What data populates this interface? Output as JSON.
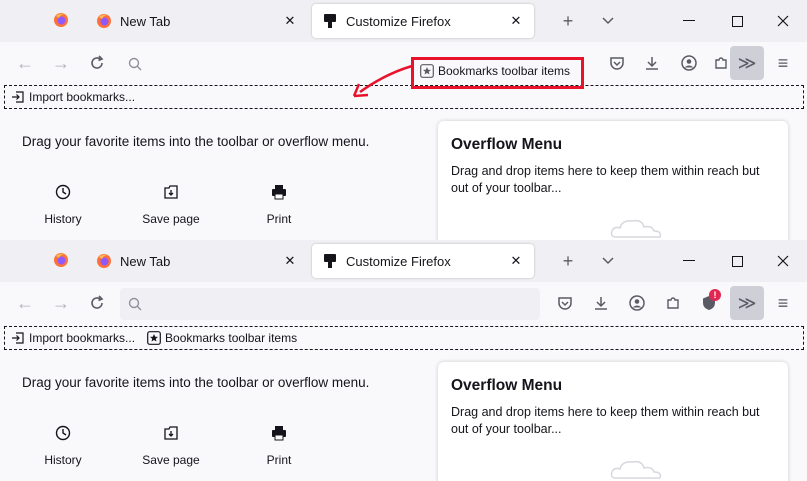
{
  "tabs": {
    "new_tab_label": "New Tab",
    "customize_label": "Customize Firefox",
    "close_glyph": "✕",
    "new_tab_button_glyph": "+",
    "list_all_tabs_glyph": "⌄"
  },
  "window_controls": {
    "minimize_glyph": "—",
    "maximize_glyph": "☐",
    "close_glyph": "✕"
  },
  "navbar": {
    "back_glyph": "←",
    "forward_glyph": "→",
    "overflow_glyph": "≫",
    "menu_glyph": "≡"
  },
  "bookmarks_toolbar": {
    "import_label": "Import bookmarks...",
    "bookmarks_items_label": "Bookmarks toolbar items"
  },
  "top_panel": {
    "dragged_item_label": "Bookmarks toolbar items"
  },
  "bottom_panel": {
    "badge_text": "!"
  },
  "customize": {
    "hint": "Drag your favorite items into the toolbar or overflow menu.",
    "palette": [
      {
        "label": "History",
        "icon": "history-icon"
      },
      {
        "label": "Save page",
        "icon": "save-page-icon"
      },
      {
        "label": "Print",
        "icon": "print-icon"
      }
    ]
  },
  "overflow_menu": {
    "title": "Overflow Menu",
    "description": "Drag and drop items here to keep them within reach but out of your toolbar..."
  },
  "colors": {
    "annotation_red": "#e8132b",
    "tabstrip_bg": "#f0f0f4",
    "selected_tab_bg": "#ffffff",
    "badge_red": "#e22850",
    "firefox_orange": "#ff7139",
    "firefox_purple": "#9059ff"
  }
}
